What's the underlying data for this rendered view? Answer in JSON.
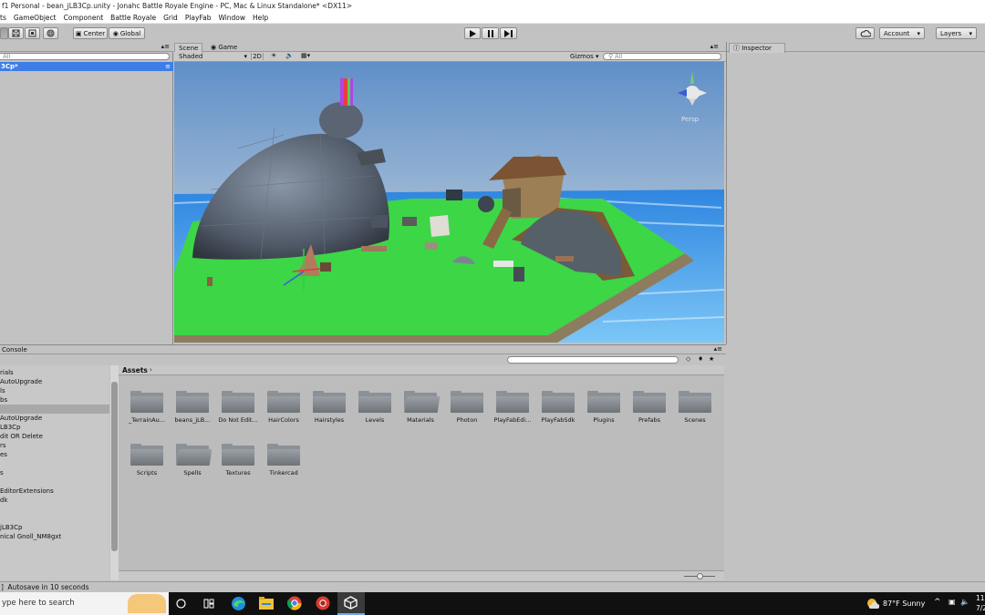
{
  "window": {
    "title": "f1 Personal - bean_jLB3Cp.unity - Jonahc Battle Royale Engine - PC, Mac & Linux Standalone* <DX11>"
  },
  "menu": [
    "ts",
    "GameObject",
    "Component",
    "Battle Royale",
    "Grid",
    "PlayFab",
    "Window",
    "Help"
  ],
  "toolbar": {
    "pivot_label": "Center",
    "space_label": "Global",
    "account_label": "Account",
    "layers_label": "Layers"
  },
  "hierarchy": {
    "search_placeholder": "All",
    "scene_item": "3Cp*"
  },
  "scene": {
    "tabs": [
      "Scene",
      "Game"
    ],
    "shading_mode": "Shaded",
    "mode_2d": "2D",
    "gizmos_label": "Gizmos",
    "search_placeholder": "All",
    "persp_label": "Persp"
  },
  "inspector": {
    "tab": "Inspector"
  },
  "bottom": {
    "console_tab": "Console",
    "breadcrumb": "Assets",
    "left_items": [
      "rials",
      "AutoUpgrade",
      "ls",
      "bs",
      "",
      "AutoUpgrade",
      "LB3Cp",
      "dit OR Delete",
      "rs",
      "es",
      "",
      "s",
      "",
      "EditorExtensions",
      "dk",
      "",
      "",
      "jLB3Cp",
      "nical Gnoll_NM8gxt"
    ],
    "folders": [
      "_TerrainAu...",
      "beans_jLB...",
      "Do Not Edit...",
      "HairColors",
      "Hairstyles",
      "Levels",
      "Materials",
      "Photon",
      "PlayFabEdi...",
      "PlayFabSdk",
      "Plugins",
      "Prefabs",
      "Scenes",
      "Scripts",
      "Spells",
      "Textures",
      "Tinkercad"
    ]
  },
  "status": {
    "message": "Autosave in 10 seconds"
  },
  "taskbar": {
    "search_placeholder": "ype here to search",
    "weather": "87°F  Sunny",
    "clock_time": "11",
    "clock_date": "7/2"
  },
  "colors": {
    "selection": "#3e7de7",
    "panel_bg": "#c2c2c2",
    "sky_top": "#5f8fc8",
    "grass": "#3cd646",
    "water": "#3aa3ef"
  }
}
